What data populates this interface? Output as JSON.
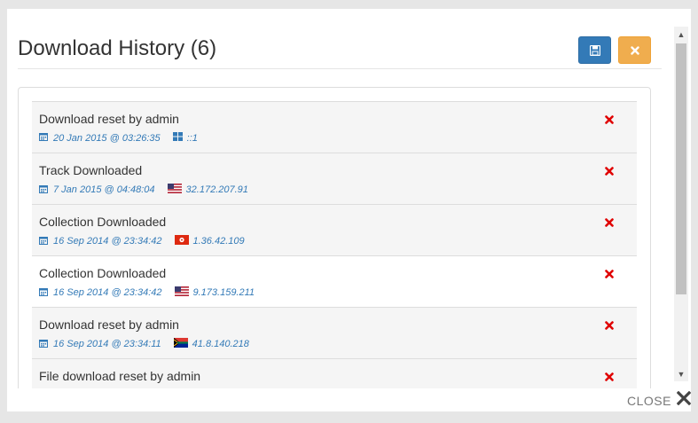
{
  "modal": {
    "title": "Download History (6)",
    "save_icon": "save-icon",
    "cancel_icon": "close-icon",
    "close_label": "CLOSE"
  },
  "colors": {
    "primary": "#337ab7",
    "warning": "#f0ad4e",
    "danger": "#e00000",
    "meta_text": "#337ab7"
  },
  "history": [
    {
      "title": "Download reset by admin",
      "date": "20 Jan 2015 @ 03:26:35",
      "source_icon": "windows-icon",
      "source": "::1"
    },
    {
      "title": "Track Downloaded",
      "date": "7 Jan 2015 @ 04:48:04",
      "source_icon": "us-flag-icon",
      "source": "32.172.207.91"
    },
    {
      "title": "Collection Downloaded",
      "date": "16 Sep 2014 @ 23:34:42",
      "source_icon": "hk-flag-icon",
      "source": "1.36.42.109"
    },
    {
      "title": "Collection Downloaded",
      "date": "16 Sep 2014 @ 23:34:42",
      "source_icon": "us-flag-icon",
      "source": "9.173.159.211"
    },
    {
      "title": "Download reset by admin",
      "date": "16 Sep 2014 @ 23:34:11",
      "source_icon": "za-flag-icon",
      "source": "41.8.140.218"
    },
    {
      "title": "File download reset by admin",
      "date": "",
      "source_icon": "",
      "source": ""
    }
  ]
}
